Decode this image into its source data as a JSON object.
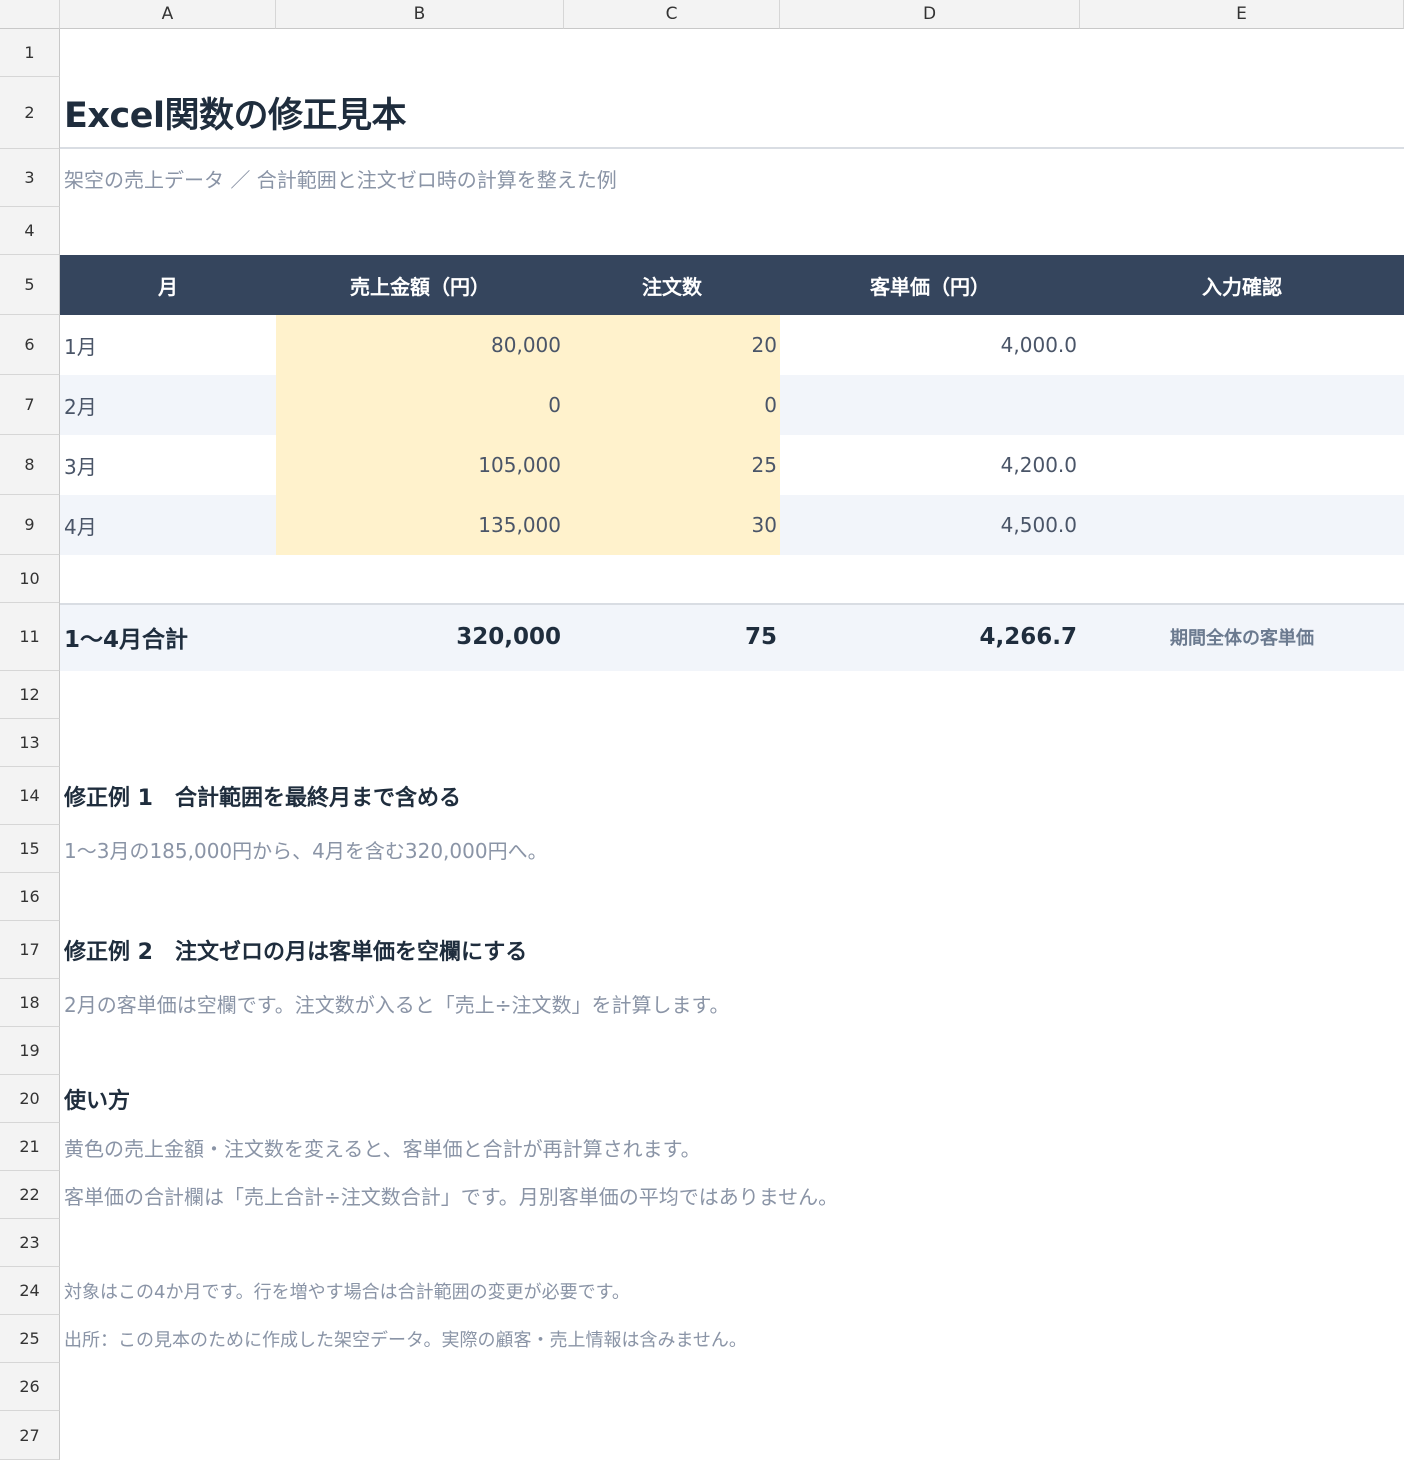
{
  "columns": [
    "A",
    "B",
    "C",
    "D",
    "E"
  ],
  "rows": [
    "1",
    "2",
    "3",
    "4",
    "5",
    "6",
    "7",
    "8",
    "9",
    "10",
    "11",
    "12",
    "13",
    "14",
    "15",
    "16",
    "17",
    "18",
    "19",
    "20",
    "21",
    "22",
    "23",
    "24",
    "25",
    "26",
    "27"
  ],
  "sheet": {
    "title": "Excel関数の修正見本",
    "subtitle": "架空の売上データ ／ 合計範囲と注文ゼロ時の計算を整えた例"
  },
  "table": {
    "headers": [
      "月",
      "売上金額（円）",
      "注文数",
      "客単価（円）",
      "入力確認"
    ],
    "rows": [
      {
        "month": "1月",
        "sales": "80,000",
        "orders": "20",
        "unit_price": "4,000.0",
        "check": ""
      },
      {
        "month": "2月",
        "sales": "0",
        "orders": "0",
        "unit_price": "",
        "check": ""
      },
      {
        "month": "3月",
        "sales": "105,000",
        "orders": "25",
        "unit_price": "4,200.0",
        "check": ""
      },
      {
        "month": "4月",
        "sales": "135,000",
        "orders": "30",
        "unit_price": "4,500.0",
        "check": ""
      }
    ],
    "total": {
      "label": "1〜4月合計",
      "sales": "320,000",
      "orders": "75",
      "unit_price": "4,266.7",
      "note": "期間全体の客単価"
    }
  },
  "notes": {
    "fix1_title": "修正例 1　合計範囲を最終月まで含める",
    "fix1_text": "1〜3月の185,000円から、4月を含む320,000円へ。",
    "fix2_title": "修正例 2　注文ゼロの月は客単価を空欄にする",
    "fix2_text": "2月の客単価は空欄です。注文数が入ると「売上÷注文数」を計算します。",
    "usage_title": "使い方",
    "usage_text1": "黄色の売上金額・注文数を変えると、客単価と合計が再計算されます。",
    "usage_text2": "客単価の合計欄は「売上合計÷注文数合計」です。月別客単価の平均ではありません。",
    "scope": "対象はこの4か月です。行を増やす場合は合計範囲の変更が必要です。",
    "source": "出所：この見本のために作成した架空データ。実際の顧客・売上情報は含みません。"
  },
  "colors": {
    "header_bg": "#35455d",
    "input_bg": "#fff2cc",
    "stripe_bg": "#f2f5fa",
    "text_dark": "#1f2d3d",
    "text_muted": "#8a94a6"
  }
}
